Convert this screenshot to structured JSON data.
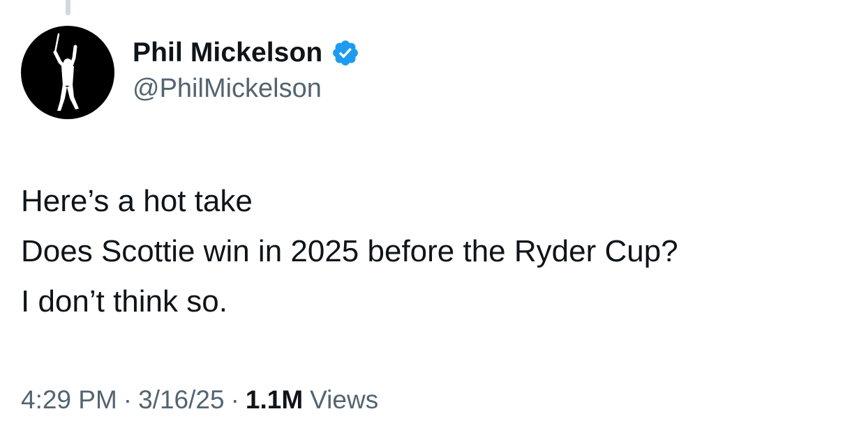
{
  "author": {
    "display_name": "Phil Mickelson",
    "handle": "@PhilMickelson",
    "verified": true,
    "avatar_icon": "golfer-silhouette-avatar",
    "verified_icon": "verified-badge-icon",
    "verified_color": "#1d9bf0"
  },
  "tweet": {
    "lines": [
      "Here’s a hot take",
      "Does Scottie win in 2025 before the Ryder Cup?",
      "I don’t think so."
    ]
  },
  "meta": {
    "time": "4:29 PM",
    "separator": "·",
    "date": "3/16/25",
    "views_count": "1.1M",
    "views_label": "Views"
  },
  "colors": {
    "text_primary": "#0f1419",
    "text_secondary": "#536471",
    "thread_line": "#cfd9de"
  }
}
